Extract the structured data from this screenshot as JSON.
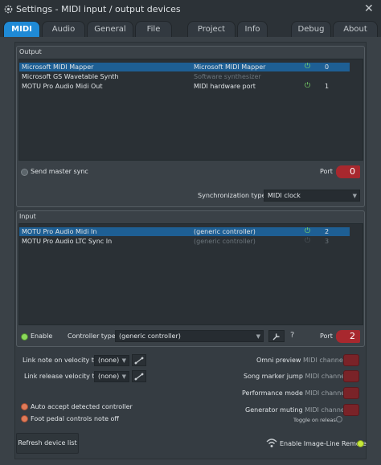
{
  "window": {
    "title": "Settings - MIDI input / output devices",
    "close_glyph": "✕"
  },
  "tabs": [
    {
      "label": "MIDI",
      "active": true
    },
    {
      "label": "Audio"
    },
    {
      "label": "General"
    },
    {
      "label": "File"
    },
    {
      "label": "Project"
    },
    {
      "label": "Info"
    },
    {
      "label": "Debug"
    },
    {
      "label": "About"
    }
  ],
  "output": {
    "section_label": "Output",
    "devices": [
      {
        "name": "Microsoft MIDI Mapper",
        "type": "Microsoft MIDI Mapper",
        "port": "0",
        "selected": true
      },
      {
        "name": "Microsoft GS Wavetable Synth",
        "type": "Software synthesizer",
        "port": ""
      },
      {
        "name": "MOTU Pro Audio Midi Out",
        "type": "MIDI hardware port",
        "port": "1"
      }
    ],
    "send_master_sync_label": "Send master sync",
    "port_label": "Port",
    "port_value": "0",
    "sync_type_label": "Synchronization type",
    "sync_type_value": "MIDI clock"
  },
  "input": {
    "section_label": "Input",
    "devices": [
      {
        "name": "MOTU Pro Audio Midi In",
        "type": "(generic controller)",
        "port": "2",
        "selected": true
      },
      {
        "name": "MOTU Pro Audio LTC Sync In",
        "type": "(generic controller)",
        "port": "3"
      }
    ],
    "enable_label": "Enable",
    "controller_type_label": "Controller type",
    "controller_type_value": "(generic controller)",
    "help_glyph": "?",
    "port_label": "Port",
    "port_value": "2"
  },
  "options": {
    "link_note_on_label": "Link note on velocity to",
    "link_note_on_value": "(none)",
    "link_release_label": "Link release velocity to",
    "link_release_value": "(none)",
    "omni_preview_label": "Omni preview",
    "song_marker_jump_label": "Song marker jump",
    "performance_mode_label": "Performance mode",
    "generator_muting_label": "Generator muting",
    "midi_channel_label": "MIDI channel",
    "toggle_on_release_label": "Toggle on release",
    "auto_accept_label": "Auto accept detected controller",
    "foot_pedal_label": "Foot pedal controls note off"
  },
  "footer": {
    "refresh_label": "Refresh device list",
    "enable_remote_label": "Enable Image-Line Remote"
  },
  "colors": {
    "accent": "#1f8ad6",
    "selected_row": "#1e5f94",
    "port_red": "#a8282e",
    "power_green": "#7ee06a"
  }
}
